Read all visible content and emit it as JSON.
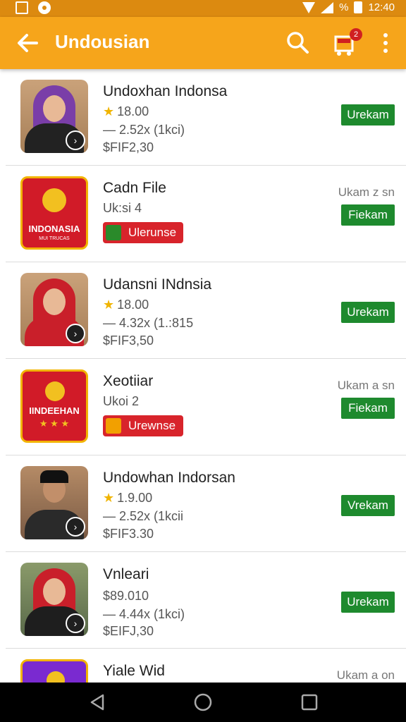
{
  "status_bar": {
    "time": "12:40",
    "battery_label": "%"
  },
  "app_bar": {
    "title": "Undousian",
    "cart_count": "2",
    "icons": [
      "back-arrow-icon",
      "search-icon",
      "cart-icon",
      "more-vert-icon"
    ]
  },
  "items": [
    {
      "title": "Undoxhan Indonsa",
      "line1": "18.00",
      "line1_star": true,
      "line2": "— 2.52x (1kci)",
      "line3": "$FIF2,30",
      "side": "",
      "button": "Urekam"
    },
    {
      "title": "Cadn File",
      "line1": "Uk:si 4",
      "line1_star": false,
      "line2": "",
      "line3": "",
      "tag": "Ulerunse",
      "side": "Ukam z sn",
      "button": "Fiekam",
      "icon_text": "INDONASIA",
      "icon_subtext": "MUI TRUCAS"
    },
    {
      "title": "Udansni INdnsia",
      "line1": "18.00",
      "line1_star": true,
      "line2": "— 4.32x (1.:815",
      "line3": "$FIF3,50",
      "side": "",
      "button": "Urekam"
    },
    {
      "title": "Xeotiiar",
      "line1": "Ukoi 2",
      "line1_star": false,
      "line2": "",
      "line3": "",
      "tag": "Urewnse",
      "side": "Ukam a sn",
      "button": "Fiekam",
      "icon_text": "IINDEEHAN"
    },
    {
      "title": "Undowhan Indorsan",
      "line1": "1.9.00",
      "line1_star": true,
      "line2": "— 2.52x (1kcii",
      "line3": "$FIF3.30",
      "side": "",
      "button": "Vrekam"
    },
    {
      "title": "Vnleari",
      "line1": "$89.010",
      "line1_star": false,
      "line2": "— 4.44x (1kci)",
      "line3": "$EIFJ,30",
      "side": "",
      "button": "Urekam"
    },
    {
      "title": "Yiale Wid",
      "line1": "",
      "line1_star": false,
      "line2": "",
      "line3": "",
      "side": "Ukam a on",
      "button": ""
    }
  ],
  "colors": {
    "app_bar": "#f6a51b",
    "status_bar": "#dc8a10",
    "button": "#1e8a2e",
    "tag": "#d8242b"
  }
}
